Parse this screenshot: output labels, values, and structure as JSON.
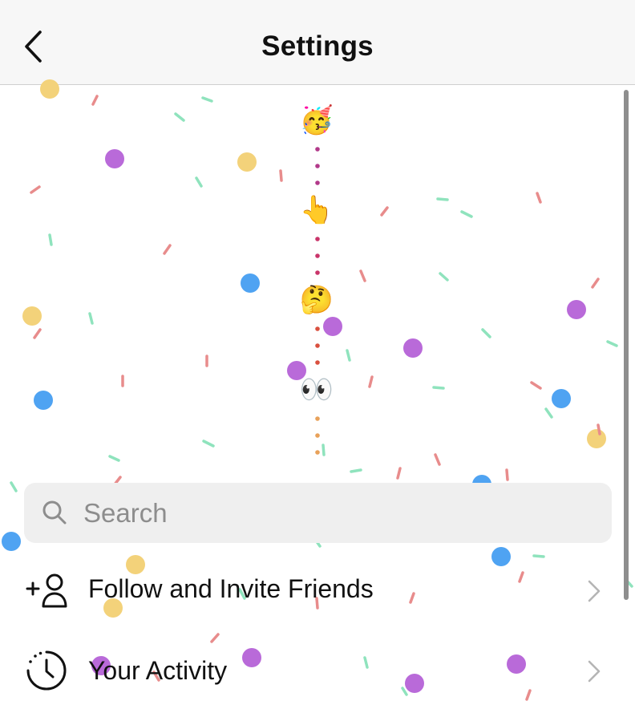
{
  "header": {
    "title": "Settings",
    "back_icon": "chevron-left-icon"
  },
  "search": {
    "placeholder": "Search",
    "value": "",
    "icon": "search-icon"
  },
  "menu": {
    "items": [
      {
        "label": "Follow and Invite Friends",
        "icon": "add-person-icon",
        "chevron": "chevron-right-icon"
      },
      {
        "label": "Your Activity",
        "icon": "activity-clock-icon",
        "chevron": "chevron-right-icon"
      }
    ]
  },
  "celebration": {
    "emojis": [
      "🥳",
      "👆",
      "🤔",
      "👀"
    ],
    "trail_colors": [
      "#b23a8a",
      "#c9356a",
      "#d9503f",
      "#e8a15a"
    ]
  },
  "colors": {
    "nav_background": "#f7f7f7",
    "search_background": "#efefef",
    "confetti": [
      "#f3d27a",
      "#b96ad9",
      "#4fa3f2",
      "#e88c8c",
      "#8fe3bd"
    ]
  }
}
